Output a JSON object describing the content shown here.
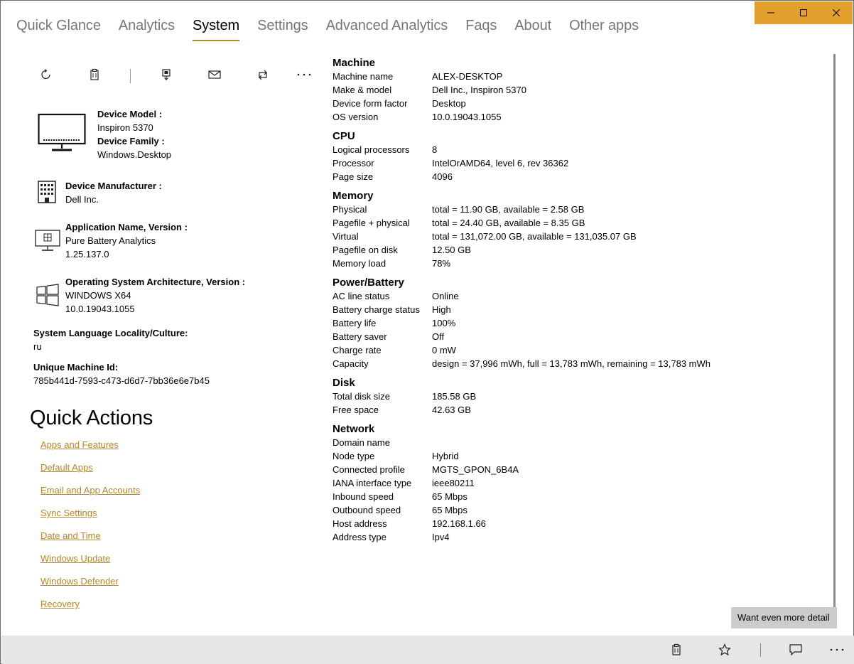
{
  "tabs": [
    {
      "label": "Quick Glance"
    },
    {
      "label": "Analytics"
    },
    {
      "label": "System"
    },
    {
      "label": "Settings"
    },
    {
      "label": "Advanced Analytics"
    },
    {
      "label": "Faqs"
    },
    {
      "label": "About"
    },
    {
      "label": "Other apps"
    }
  ],
  "active_tab": "System",
  "accent_color": "#b8862b",
  "caption_color": "#e1a12c",
  "toolbar_icons": [
    "refresh-icon",
    "clipboard-icon",
    "save-icon",
    "mail-icon",
    "share-icon",
    "more-icon"
  ],
  "device": {
    "model_label": "Device Model :",
    "model_value": "Inspiron 5370",
    "family_label": "Device Family :",
    "family_value": "Windows.Desktop",
    "manufacturer_label": "Device Manufacturer :",
    "manufacturer_value": "Dell Inc.",
    "app_label": "Application Name, Version :",
    "app_name": "Pure Battery Analytics",
    "app_version": "1.25.137.0",
    "os_label": "Operating System Architecture, Version :",
    "os_arch": "WINDOWS X64",
    "os_version": "10.0.19043.1055",
    "lang_label": "System Language Locality/Culture:",
    "lang_value": "ru",
    "machine_id_label": "Unique Machine Id:",
    "machine_id_value": "785b441d-7593-c473-d6d7-7bb36e6e7b45"
  },
  "quick_actions": {
    "title": "Quick Actions",
    "links": [
      "Apps and Features",
      "Default Apps",
      "Email and App Accounts",
      "Sync Settings",
      "Date and Time",
      "Windows Update",
      "Windows Defender",
      "Recovery"
    ]
  },
  "sections": [
    {
      "title": "Machine",
      "rows": [
        {
          "k": "Machine name",
          "v": "ALEX-DESKTOP"
        },
        {
          "k": "Make & model",
          "v": "Dell Inc., Inspiron 5370"
        },
        {
          "k": "Device form factor",
          "v": "Desktop"
        },
        {
          "k": "OS version",
          "v": "10.0.19043.1055"
        }
      ]
    },
    {
      "title": "CPU",
      "rows": [
        {
          "k": "Logical processors",
          "v": "8"
        },
        {
          "k": "Processor",
          "v": "IntelOrAMD64, level 6, rev 36362"
        },
        {
          "k": "Page size",
          "v": "4096"
        }
      ]
    },
    {
      "title": "Memory",
      "rows": [
        {
          "k": "Physical",
          "v": "total = 11.90 GB, available = 2.58 GB"
        },
        {
          "k": "Pagefile + physical",
          "v": "total = 24.40 GB, available = 8.35 GB"
        },
        {
          "k": "Virtual",
          "v": "total = 131,072.00 GB, available = 131,035.07 GB"
        },
        {
          "k": "Pagefile on disk",
          "v": "12.50 GB"
        },
        {
          "k": "Memory load",
          "v": "78%"
        }
      ]
    },
    {
      "title": "Power/Battery",
      "rows": [
        {
          "k": "AC line status",
          "v": "Online"
        },
        {
          "k": "Battery charge status",
          "v": "High"
        },
        {
          "k": "Battery life",
          "v": "100%"
        },
        {
          "k": "Battery saver",
          "v": "Off"
        },
        {
          "k": "Charge rate",
          "v": "0 mW"
        },
        {
          "k": "Capacity",
          "v": "design = 37,996 mWh, full = 13,783 mWh, remaining = 13,783 mWh"
        }
      ]
    },
    {
      "title": "Disk",
      "rows": [
        {
          "k": "Total disk size",
          "v": "185.58 GB"
        },
        {
          "k": "Free space",
          "v": "42.63 GB"
        }
      ]
    },
    {
      "title": "Network",
      "rows": [
        {
          "k": "Domain name",
          "v": ""
        },
        {
          "k": "Node type",
          "v": "Hybrid"
        },
        {
          "k": "Connected profile",
          "v": "MGTS_GPON_6B4A"
        },
        {
          "k": "IANA interface type",
          "v": "ieee80211"
        },
        {
          "k": "Inbound speed",
          "v": "65 Mbps"
        },
        {
          "k": "Outbound speed",
          "v": "65 Mbps"
        },
        {
          "k": "Host address",
          "v": "192.168.1.66"
        },
        {
          "k": "Address type",
          "v": "Ipv4"
        }
      ]
    }
  ],
  "more_detail_button": "Want even more detail",
  "command_bar_icons": [
    "clipboard-icon",
    "star-icon",
    "feedback-icon",
    "more-icon"
  ]
}
